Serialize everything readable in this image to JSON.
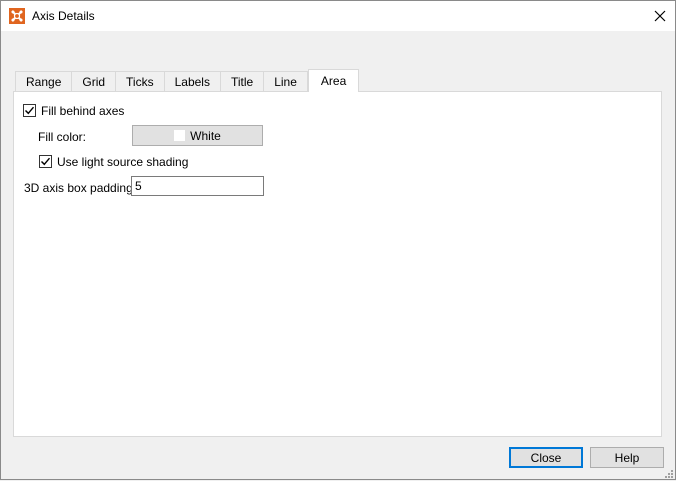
{
  "window": {
    "title": "Axis Details",
    "icon": "app-logo-icon",
    "close_icon": "close-icon"
  },
  "tabs": [
    {
      "label": "Range",
      "active": false
    },
    {
      "label": "Grid",
      "active": false
    },
    {
      "label": "Ticks",
      "active": false
    },
    {
      "label": "Labels",
      "active": false
    },
    {
      "label": "Title",
      "active": false
    },
    {
      "label": "Line",
      "active": false
    },
    {
      "label": "Area",
      "active": true
    }
  ],
  "area": {
    "fill_behind_axes": {
      "label": "Fill behind axes",
      "checked": true
    },
    "fill_color": {
      "label": "Fill color:",
      "value": "White",
      "swatch": "#ffffff"
    },
    "light_shading": {
      "label": "Use light source shading",
      "checked": true
    },
    "padding": {
      "label": "3D axis box padding:",
      "value": "5"
    }
  },
  "buttons": {
    "close": "Close",
    "help": "Help"
  },
  "colors": {
    "accent": "#0078d7",
    "panel": "#ffffff",
    "background": "#f0f0f0"
  }
}
